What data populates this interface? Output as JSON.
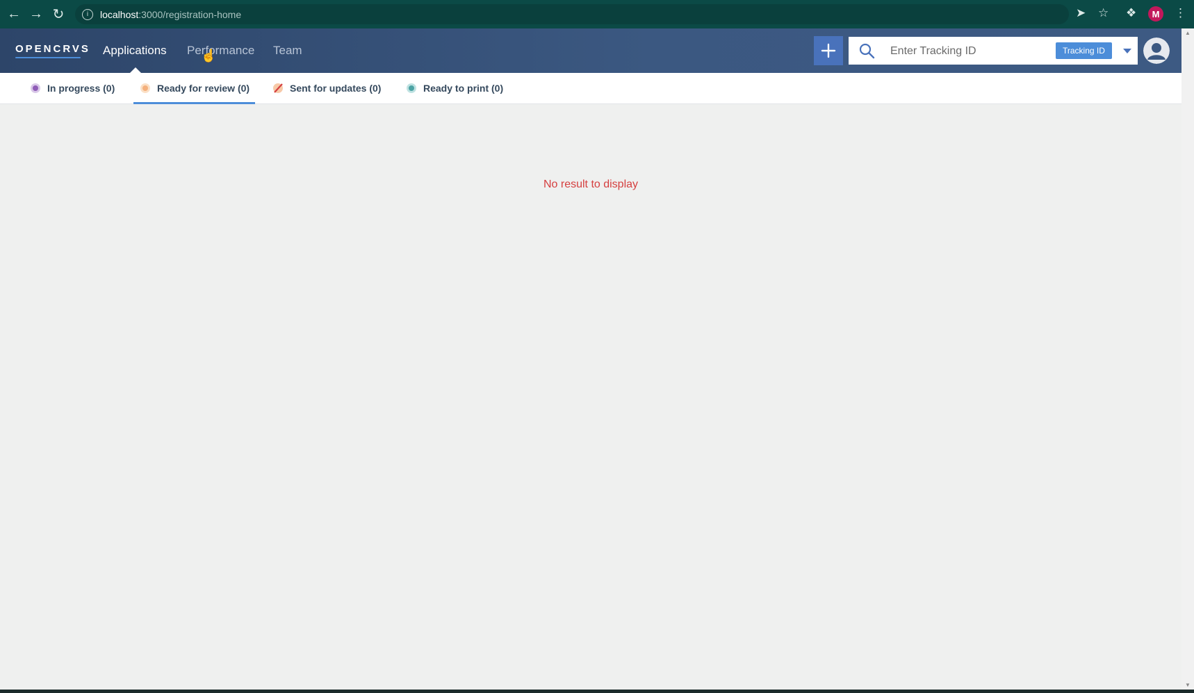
{
  "browser": {
    "url_host": "localhost",
    "url_path": ":3000/registration-home",
    "profile_initial": "M"
  },
  "header": {
    "logo": "OPENCRVS",
    "nav": [
      "Applications",
      "Performance",
      "Team"
    ],
    "active_nav": "Applications",
    "search_placeholder": "Enter Tracking ID",
    "search_type": "Tracking ID"
  },
  "tabs": [
    {
      "label": "In progress (0)",
      "icon": "in-progress-icon",
      "color": "#8f5cb7"
    },
    {
      "label": "Ready for review (0)",
      "icon": "ready-for-review-icon",
      "color": "#f4b07d",
      "active": true
    },
    {
      "label": "Sent for updates (0)",
      "icon": "sent-for-updates-icon",
      "color": "#d53f3f"
    },
    {
      "label": "Ready to print (0)",
      "icon": "ready-to-print-icon",
      "color": "#4ca3a4"
    }
  ],
  "main": {
    "empty_message": "No result to display"
  },
  "colors": {
    "header_start": "#2d4569",
    "header_end": "#3d5a83",
    "accent": "#4c8dd9",
    "error_text": "#d53f3f"
  }
}
